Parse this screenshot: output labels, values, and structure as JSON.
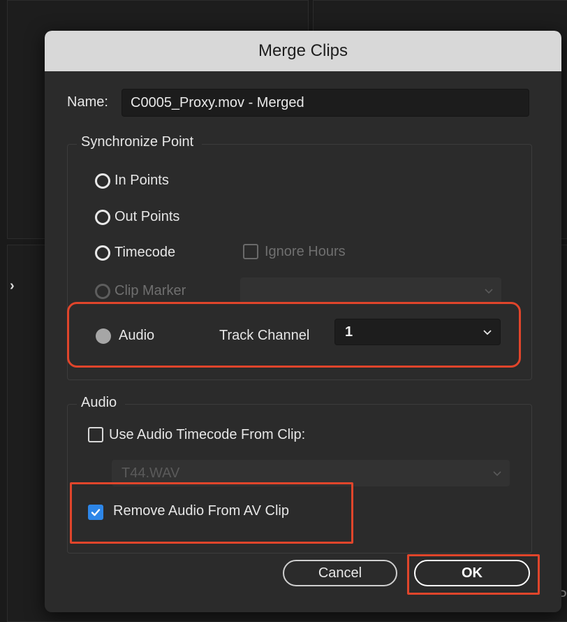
{
  "dialog": {
    "title": "Merge Clips",
    "name_label": "Name:",
    "name_value": "C0005_Proxy.mov - Merged",
    "sync_group_title": "Synchronize Point",
    "sync_options": {
      "in_points": "In Points",
      "out_points": "Out Points",
      "timecode": "Timecode",
      "ignore_hours": "Ignore Hours",
      "clip_marker": "Clip Marker",
      "audio": "Audio",
      "track_channel_label": "Track Channel",
      "track_channel_value": "1",
      "selected": "audio"
    },
    "audio_group_title": "Audio",
    "use_audio_timecode_label": "Use Audio Timecode From Clip:",
    "use_audio_timecode_checked": false,
    "audio_clip_value": "T44.WAV",
    "remove_audio_label": "Remove Audio From AV Clip",
    "remove_audio_checked": true,
    "cancel_label": "Cancel",
    "ok_label": "OK"
  },
  "background": {
    "cut_off_text": "P"
  },
  "colors": {
    "highlight": "#e0452b",
    "checkbox_accent": "#2d86e8",
    "dialog_bg": "#2b2b2b",
    "titlebar_bg": "#d8d8d8"
  }
}
